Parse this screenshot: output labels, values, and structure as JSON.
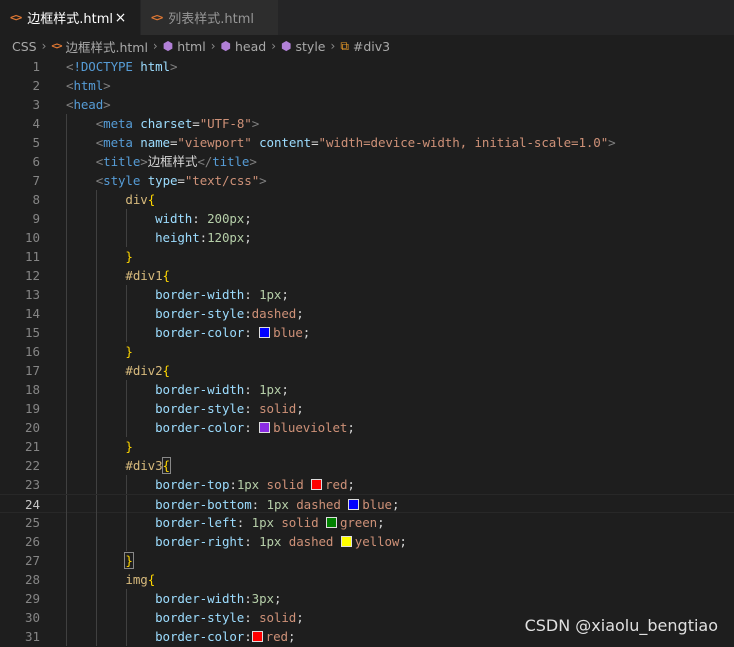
{
  "tabs": [
    {
      "label": "边框样式.html",
      "active": true,
      "close": "×"
    },
    {
      "label": "列表样式.html",
      "active": false
    }
  ],
  "icons": {
    "html_file": "<>",
    "element": "⬢",
    "selector": "⧉"
  },
  "breadcrumb": {
    "items": [
      "CSS",
      "边框样式.html",
      "html",
      "head",
      "style",
      "#div3"
    ],
    "separator": "›"
  },
  "editor": {
    "current_line": 24,
    "lines": [
      {
        "n": "1",
        "tokens": [
          [
            "t-br",
            "<"
          ],
          [
            "t-tag",
            "!DOCTYPE"
          ],
          [
            "t-txt",
            " "
          ],
          [
            "t-attr",
            "html"
          ],
          [
            "t-br",
            ">"
          ]
        ]
      },
      {
        "n": "2",
        "tokens": [
          [
            "t-br",
            "<"
          ],
          [
            "t-tag",
            "html"
          ],
          [
            "t-br",
            ">"
          ]
        ]
      },
      {
        "n": "3",
        "tokens": [
          [
            "t-br",
            "<"
          ],
          [
            "t-tag",
            "head"
          ],
          [
            "t-br",
            ">"
          ]
        ]
      },
      {
        "n": "4",
        "tokens": [
          [
            "t-txt",
            "    "
          ],
          [
            "t-br",
            "<"
          ],
          [
            "t-tag",
            "meta"
          ],
          [
            "t-txt",
            " "
          ],
          [
            "t-attr",
            "charset"
          ],
          [
            "t-txt",
            "="
          ],
          [
            "t-str",
            "\"UTF-8\""
          ],
          [
            "t-br",
            ">"
          ]
        ]
      },
      {
        "n": "5",
        "tokens": [
          [
            "t-txt",
            "    "
          ],
          [
            "t-br",
            "<"
          ],
          [
            "t-tag",
            "meta"
          ],
          [
            "t-txt",
            " "
          ],
          [
            "t-attr",
            "name"
          ],
          [
            "t-txt",
            "="
          ],
          [
            "t-str",
            "\"viewport\""
          ],
          [
            "t-txt",
            " "
          ],
          [
            "t-attr",
            "content"
          ],
          [
            "t-txt",
            "="
          ],
          [
            "t-str",
            "\"width=device-width, initial-scale=1.0\""
          ],
          [
            "t-br",
            ">"
          ]
        ]
      },
      {
        "n": "6",
        "tokens": [
          [
            "t-txt",
            "    "
          ],
          [
            "t-br",
            "<"
          ],
          [
            "t-tag",
            "title"
          ],
          [
            "t-br",
            ">"
          ],
          [
            "t-txt",
            "边框样式"
          ],
          [
            "t-br",
            "</"
          ],
          [
            "t-tag",
            "title"
          ],
          [
            "t-br",
            ">"
          ]
        ]
      },
      {
        "n": "7",
        "tokens": [
          [
            "t-txt",
            "    "
          ],
          [
            "t-br",
            "<"
          ],
          [
            "t-tag",
            "style"
          ],
          [
            "t-txt",
            " "
          ],
          [
            "t-attr",
            "type"
          ],
          [
            "t-txt",
            "="
          ],
          [
            "t-str",
            "\"text/css\""
          ],
          [
            "t-br",
            ">"
          ]
        ]
      },
      {
        "n": "8",
        "tokens": [
          [
            "t-txt",
            "        "
          ],
          [
            "t-sel",
            "div"
          ],
          [
            "t-brace",
            "{"
          ]
        ]
      },
      {
        "n": "9",
        "tokens": [
          [
            "t-txt",
            "            "
          ],
          [
            "t-prop",
            "width"
          ],
          [
            "t-txt",
            ": "
          ],
          [
            "t-num",
            "200px"
          ],
          [
            "t-txt",
            ";"
          ]
        ]
      },
      {
        "n": "10",
        "tokens": [
          [
            "t-txt",
            "            "
          ],
          [
            "t-prop",
            "height"
          ],
          [
            "t-txt",
            ":"
          ],
          [
            "t-num",
            "120px"
          ],
          [
            "t-txt",
            ";"
          ]
        ]
      },
      {
        "n": "11",
        "tokens": [
          [
            "t-txt",
            "        "
          ],
          [
            "t-brace",
            "}"
          ]
        ]
      },
      {
        "n": "12",
        "tokens": [
          [
            "t-txt",
            "        "
          ],
          [
            "t-sel",
            "#div1"
          ],
          [
            "t-brace",
            "{"
          ]
        ]
      },
      {
        "n": "13",
        "tokens": [
          [
            "t-txt",
            "            "
          ],
          [
            "t-prop",
            "border-width"
          ],
          [
            "t-txt",
            ": "
          ],
          [
            "t-num",
            "1px"
          ],
          [
            "t-txt",
            ";"
          ]
        ]
      },
      {
        "n": "14",
        "tokens": [
          [
            "t-txt",
            "            "
          ],
          [
            "t-prop",
            "border-style"
          ],
          [
            "t-txt",
            ":"
          ],
          [
            "t-val",
            "dashed"
          ],
          [
            "t-txt",
            ";"
          ]
        ]
      },
      {
        "n": "15",
        "tokens": [
          [
            "t-txt",
            "            "
          ],
          [
            "t-prop",
            "border-color"
          ],
          [
            "t-txt",
            ": "
          ],
          [
            "swatch",
            "#0000ff"
          ],
          [
            "t-val",
            "blue"
          ],
          [
            "t-txt",
            ";"
          ]
        ]
      },
      {
        "n": "16",
        "tokens": [
          [
            "t-txt",
            "        "
          ],
          [
            "t-brace",
            "}"
          ]
        ]
      },
      {
        "n": "17",
        "tokens": [
          [
            "t-txt",
            "        "
          ],
          [
            "t-sel",
            "#div2"
          ],
          [
            "t-brace",
            "{"
          ]
        ]
      },
      {
        "n": "18",
        "tokens": [
          [
            "t-txt",
            "            "
          ],
          [
            "t-prop",
            "border-width"
          ],
          [
            "t-txt",
            ": "
          ],
          [
            "t-num",
            "1px"
          ],
          [
            "t-txt",
            ";"
          ]
        ]
      },
      {
        "n": "19",
        "tokens": [
          [
            "t-txt",
            "            "
          ],
          [
            "t-prop",
            "border-style"
          ],
          [
            "t-txt",
            ": "
          ],
          [
            "t-val",
            "solid"
          ],
          [
            "t-txt",
            ";"
          ]
        ]
      },
      {
        "n": "20",
        "tokens": [
          [
            "t-txt",
            "            "
          ],
          [
            "t-prop",
            "border-color"
          ],
          [
            "t-txt",
            ": "
          ],
          [
            "swatch",
            "#8a2be2"
          ],
          [
            "t-val",
            "blueviolet"
          ],
          [
            "t-txt",
            ";"
          ]
        ]
      },
      {
        "n": "21",
        "tokens": [
          [
            "t-txt",
            "        "
          ],
          [
            "t-brace",
            "}"
          ]
        ]
      },
      {
        "n": "22",
        "tokens": [
          [
            "t-txt",
            "        "
          ],
          [
            "t-sel",
            "#div3"
          ],
          [
            "t-brace-hl",
            "{"
          ]
        ]
      },
      {
        "n": "23",
        "tokens": [
          [
            "t-txt",
            "            "
          ],
          [
            "t-prop",
            "border-top"
          ],
          [
            "t-txt",
            ":"
          ],
          [
            "t-num",
            "1px"
          ],
          [
            "t-txt",
            " "
          ],
          [
            "t-val",
            "solid"
          ],
          [
            "t-txt",
            " "
          ],
          [
            "swatch",
            "#ff0000"
          ],
          [
            "t-val",
            "red"
          ],
          [
            "t-txt",
            ";"
          ]
        ]
      },
      {
        "n": "24",
        "tokens": [
          [
            "t-txt",
            "            "
          ],
          [
            "t-prop",
            "border-bottom"
          ],
          [
            "t-txt",
            ": "
          ],
          [
            "t-num",
            "1px"
          ],
          [
            "t-txt",
            " "
          ],
          [
            "t-val",
            "dashed"
          ],
          [
            "t-txt",
            " "
          ],
          [
            "swatch",
            "#0000ff"
          ],
          [
            "t-val",
            "blue"
          ],
          [
            "t-txt",
            ";"
          ]
        ]
      },
      {
        "n": "25",
        "tokens": [
          [
            "t-txt",
            "            "
          ],
          [
            "t-prop",
            "border-left"
          ],
          [
            "t-txt",
            ": "
          ],
          [
            "t-num",
            "1px"
          ],
          [
            "t-txt",
            " "
          ],
          [
            "t-val",
            "solid"
          ],
          [
            "t-txt",
            " "
          ],
          [
            "swatch",
            "#008000"
          ],
          [
            "t-val",
            "green"
          ],
          [
            "t-txt",
            ";"
          ]
        ]
      },
      {
        "n": "26",
        "tokens": [
          [
            "t-txt",
            "            "
          ],
          [
            "t-prop",
            "border-right"
          ],
          [
            "t-txt",
            ": "
          ],
          [
            "t-num",
            "1px"
          ],
          [
            "t-txt",
            " "
          ],
          [
            "t-val",
            "dashed"
          ],
          [
            "t-txt",
            " "
          ],
          [
            "swatch",
            "#ffff00"
          ],
          [
            "t-val",
            "yellow"
          ],
          [
            "t-txt",
            ";"
          ]
        ]
      },
      {
        "n": "27",
        "tokens": [
          [
            "t-txt",
            "        "
          ],
          [
            "t-brace-hl",
            "}"
          ]
        ]
      },
      {
        "n": "28",
        "tokens": [
          [
            "t-txt",
            "        "
          ],
          [
            "t-sel",
            "img"
          ],
          [
            "t-brace",
            "{"
          ]
        ]
      },
      {
        "n": "29",
        "tokens": [
          [
            "t-txt",
            "            "
          ],
          [
            "t-prop",
            "border-width"
          ],
          [
            "t-txt",
            ":"
          ],
          [
            "t-num",
            "3px"
          ],
          [
            "t-txt",
            ";"
          ]
        ]
      },
      {
        "n": "30",
        "tokens": [
          [
            "t-txt",
            "            "
          ],
          [
            "t-prop",
            "border-style"
          ],
          [
            "t-txt",
            ": "
          ],
          [
            "t-val",
            "solid"
          ],
          [
            "t-txt",
            ";"
          ]
        ]
      },
      {
        "n": "31",
        "tokens": [
          [
            "t-txt",
            "            "
          ],
          [
            "t-prop",
            "border-color"
          ],
          [
            "t-txt",
            ":"
          ],
          [
            "swatch",
            "#ff0000"
          ],
          [
            "t-val",
            "red"
          ],
          [
            "t-txt",
            ";"
          ]
        ]
      }
    ]
  },
  "watermark": "CSDN @xiaolu_bengtiao"
}
